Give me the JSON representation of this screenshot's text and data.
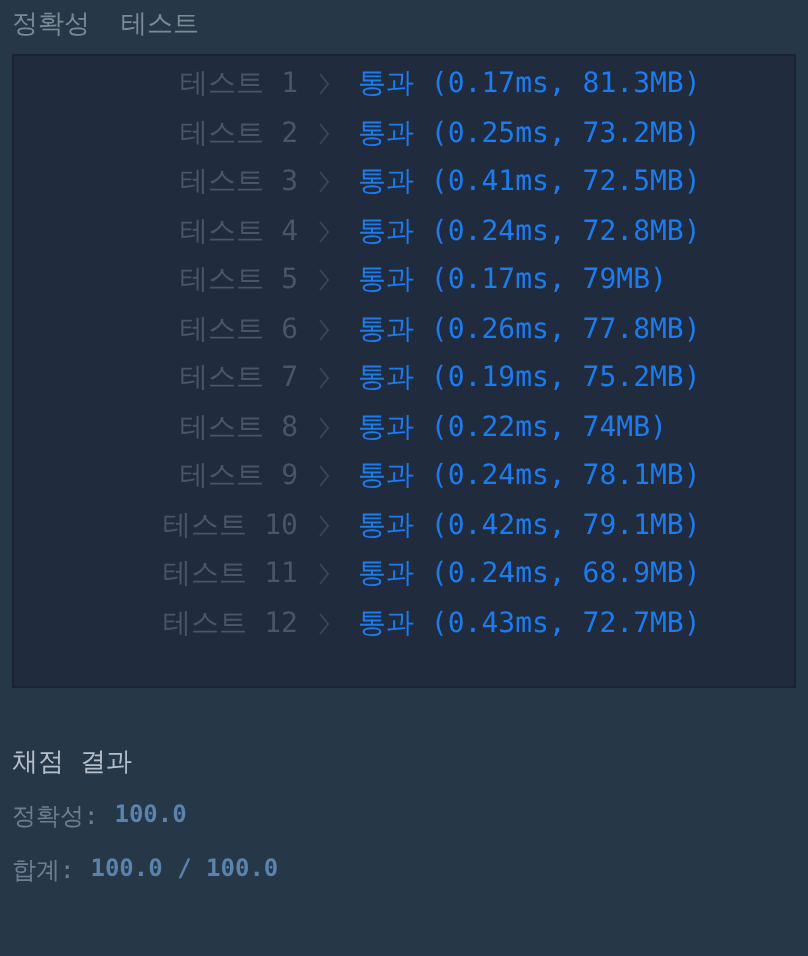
{
  "header": {
    "title": "정확성  테스트"
  },
  "tests": [
    {
      "label": "테스트 1",
      "result": "통과 (0.17ms, 81.3MB)"
    },
    {
      "label": "테스트 2",
      "result": "통과 (0.25ms, 73.2MB)"
    },
    {
      "label": "테스트 3",
      "result": "통과 (0.41ms, 72.5MB)"
    },
    {
      "label": "테스트 4",
      "result": "통과 (0.24ms, 72.8MB)"
    },
    {
      "label": "테스트 5",
      "result": "통과 (0.17ms, 79MB)"
    },
    {
      "label": "테스트 6",
      "result": "통과 (0.26ms, 77.8MB)"
    },
    {
      "label": "테스트 7",
      "result": "통과 (0.19ms, 75.2MB)"
    },
    {
      "label": "테스트 8",
      "result": "통과 (0.22ms, 74MB)"
    },
    {
      "label": "테스트 9",
      "result": "통과 (0.24ms, 78.1MB)"
    },
    {
      "label": "테스트 10",
      "result": "통과 (0.42ms, 79.1MB)"
    },
    {
      "label": "테스트 11",
      "result": "통과 (0.24ms, 68.9MB)"
    },
    {
      "label": "테스트 12",
      "result": "통과 (0.43ms, 72.7MB)"
    }
  ],
  "summary": {
    "title": "채점 결과",
    "lines": [
      {
        "label": "정확성:",
        "value": "100.0"
      },
      {
        "label": "합계:",
        "value": "100.0 / 100.0"
      }
    ]
  }
}
